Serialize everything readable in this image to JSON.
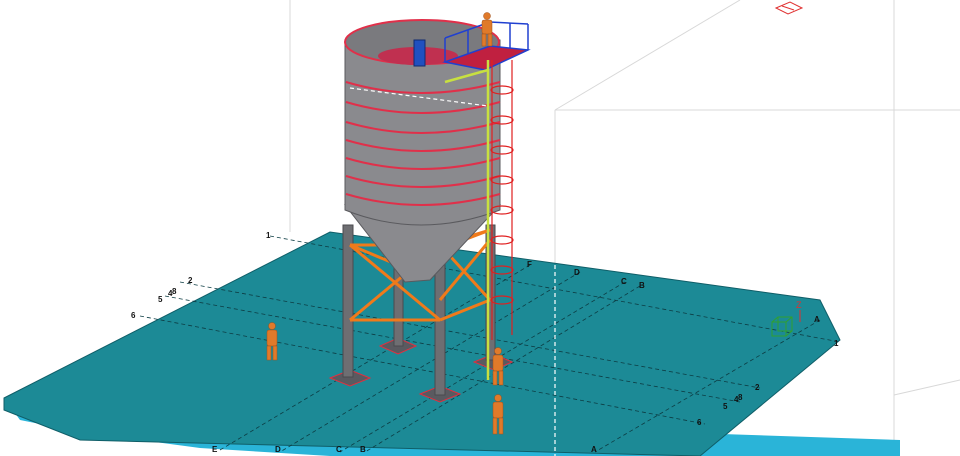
{
  "viewport": {
    "background": "#ffffff",
    "slab_color": "#1c8a96",
    "slab_edge_color": "#2ab4d8",
    "silo_color": "#8a8a8e",
    "ring_color": "#e0304a",
    "bracing_color": "#f07a1a",
    "column_color": "#6e6e72",
    "ladder_color": "#e02020",
    "railing_color": "#2040d0",
    "human_color": "#e07a2a"
  },
  "grid_labels": {
    "left_row": [
      "1",
      "2",
      "4",
      "5",
      "6",
      "8"
    ],
    "front_row": [
      "E",
      "D",
      "C",
      "B",
      "A"
    ],
    "back_row": [
      "F",
      "D",
      "C",
      "B"
    ],
    "right_row": [
      "A",
      "1",
      "2",
      "4",
      "5",
      "6",
      "8"
    ]
  },
  "axis": {
    "z_label": "Z"
  },
  "icons": {
    "view_cube": "view-cube-icon",
    "nav_gizmo": "navigation-gizmo-icon"
  }
}
